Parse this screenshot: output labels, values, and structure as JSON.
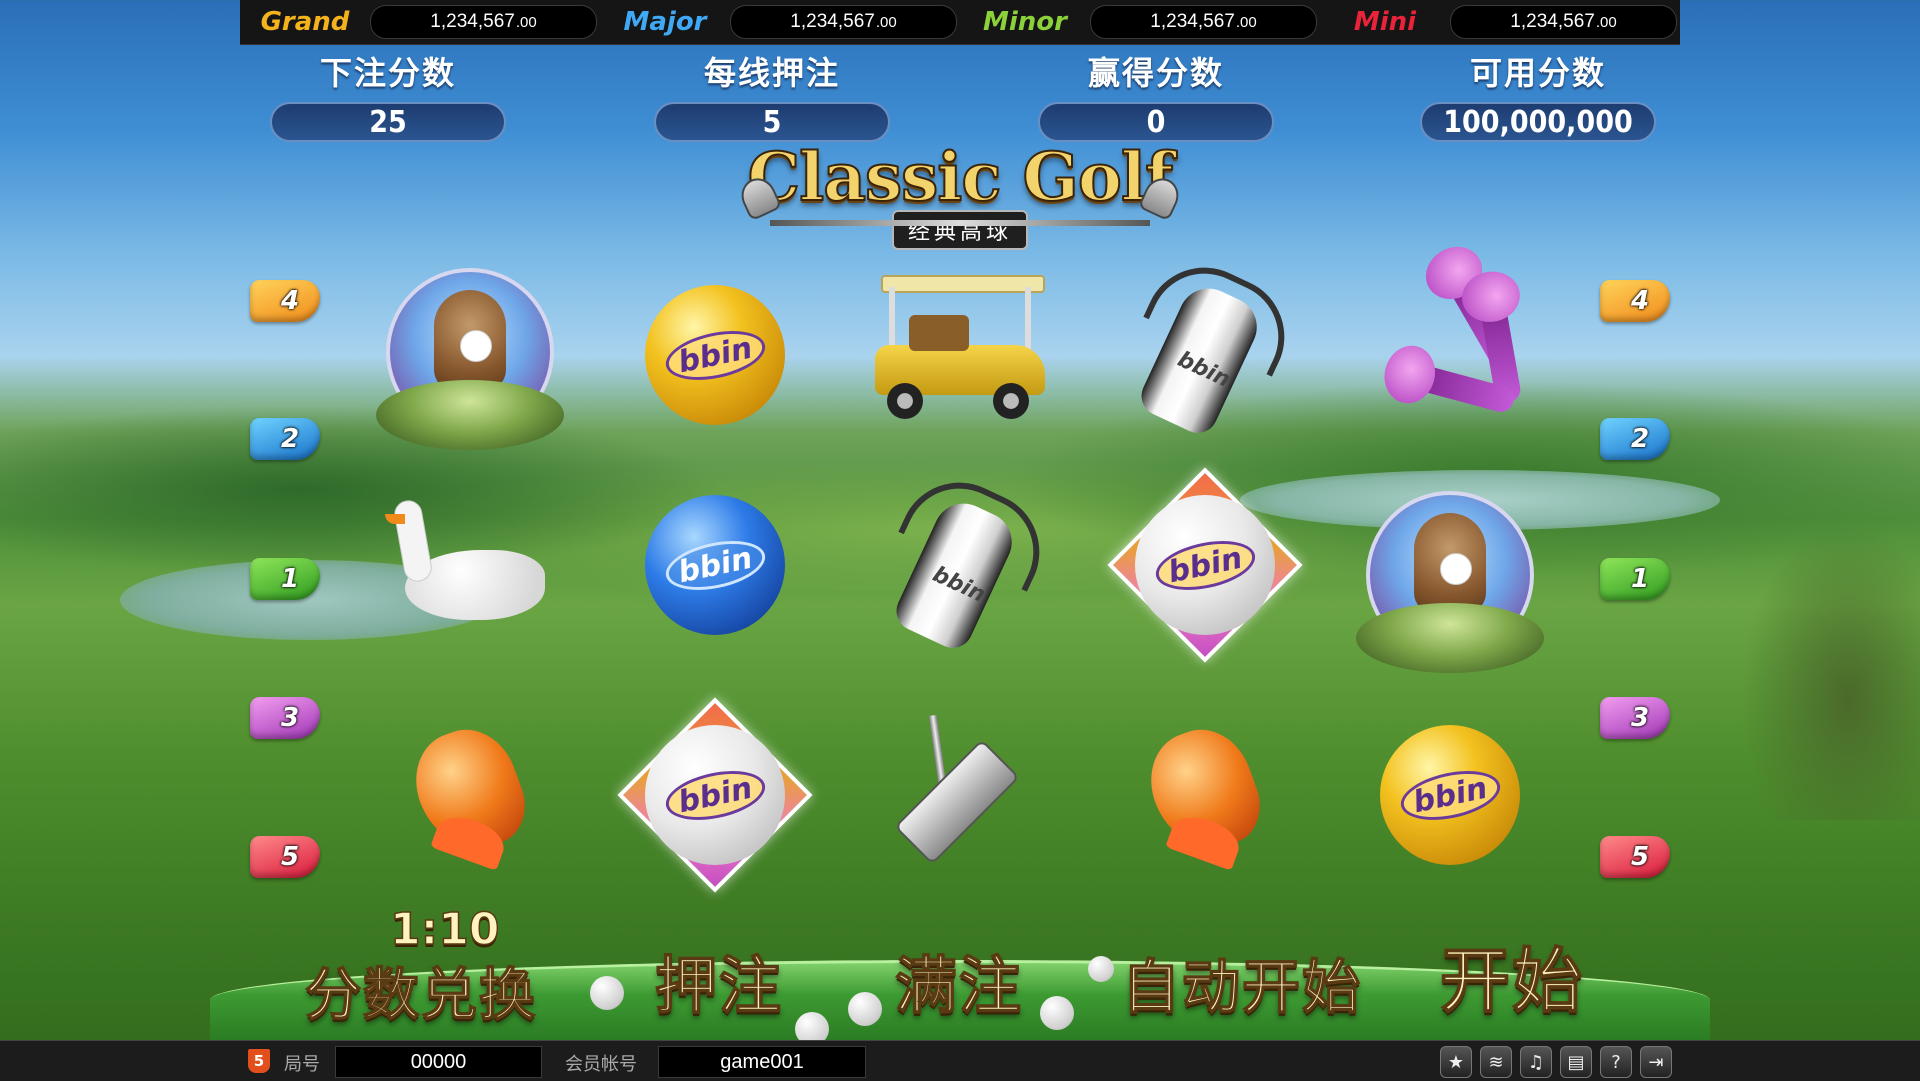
{
  "jackpots": [
    {
      "label": "Grand",
      "value": "1,234,567",
      "cents": ".00",
      "color": "#f4b21c"
    },
    {
      "label": "Major",
      "value": "1,234,567",
      "cents": ".00",
      "color": "#3fa9f5"
    },
    {
      "label": "Minor",
      "value": "1,234,567",
      "cents": ".00",
      "color": "#8bd13a"
    },
    {
      "label": "Mini",
      "value": "1,234,567",
      "cents": ".00",
      "color": "#e8233a"
    }
  ],
  "stats": {
    "bet": {
      "label": "下注分数",
      "value": "25"
    },
    "line_bet": {
      "label": "每线押注",
      "value": "5"
    },
    "win": {
      "label": "赢得分数",
      "value": "0"
    },
    "credit": {
      "label": "可用分数",
      "value": "100,000,000"
    }
  },
  "logo": {
    "title": "Classic Golf",
    "subtitle": "经典高球"
  },
  "line_markers": {
    "left": [
      "4",
      "2",
      "1",
      "3",
      "5"
    ],
    "right": [
      "4",
      "2",
      "1",
      "3",
      "5"
    ]
  },
  "reels": {
    "symbols": [
      [
        "gopher-nest",
        "swan",
        "carp-fish"
      ],
      [
        "gold-golf-ball",
        "blue-golf-ball",
        "diamond-golf-ball"
      ],
      [
        "golf-cart",
        "golf-bag",
        "putter"
      ],
      [
        "golf-bag",
        "diamond-golf-ball",
        "carp-fish"
      ],
      [
        "golf-tees",
        "gopher-nest",
        "gold-golf-ball"
      ]
    ],
    "brand_text": "bbin"
  },
  "controls": {
    "ratio": "1:10",
    "exchange": "分数兑换",
    "bet": "押注",
    "max_bet": "满注",
    "auto_start": "自动开始",
    "start": "开始"
  },
  "status_bar": {
    "html5_badge": "5",
    "round_label": "局号",
    "round_value": "00000",
    "account_label": "会员帐号",
    "account_value": "game001",
    "icons": [
      "cashier-icon",
      "rss-icon",
      "music-icon",
      "history-icon",
      "help-icon",
      "exit-icon"
    ]
  }
}
